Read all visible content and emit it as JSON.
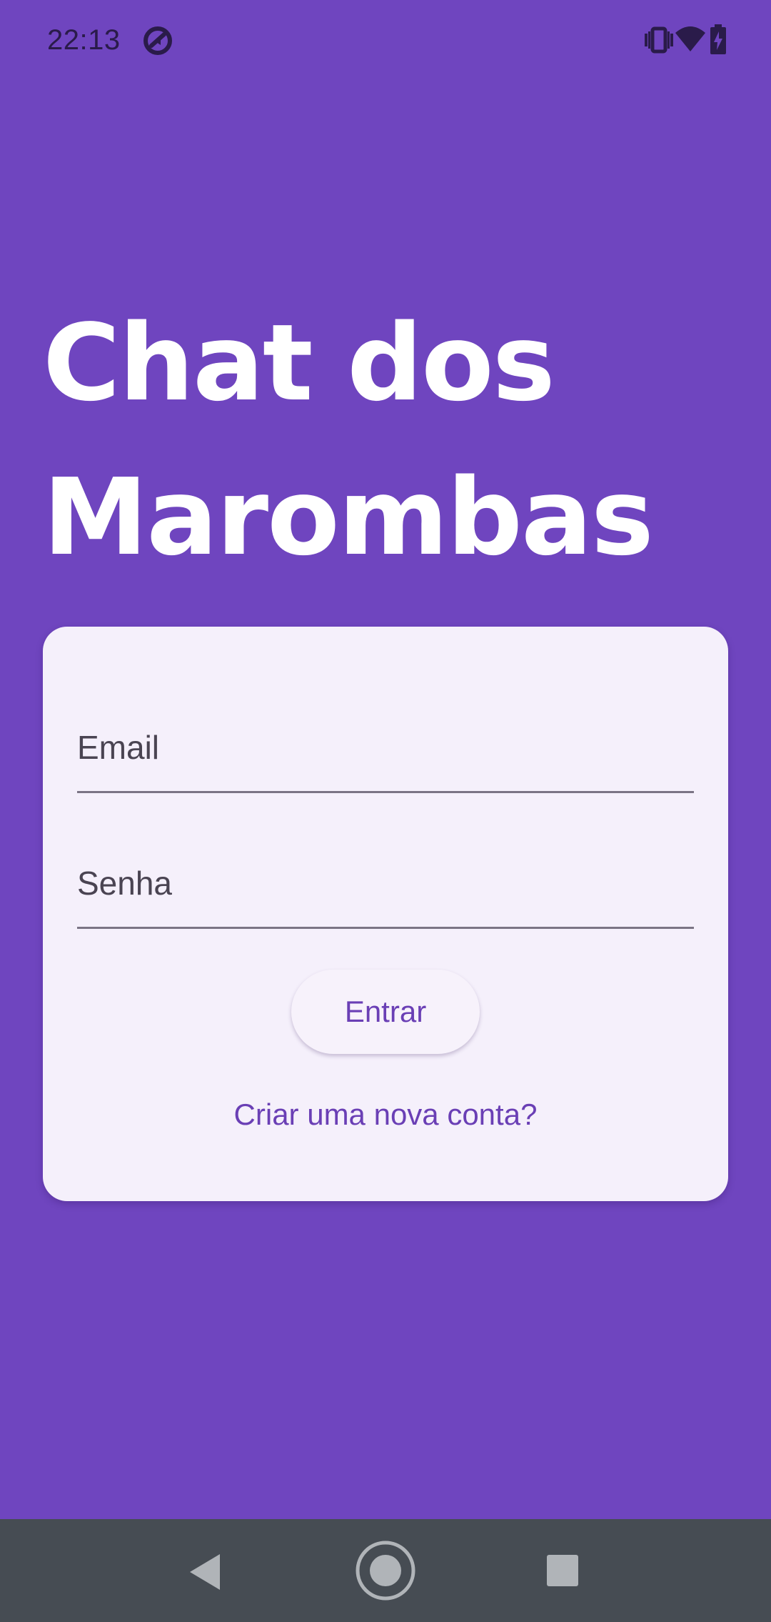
{
  "status_bar": {
    "time": "22:13",
    "icons": [
      "sync-badge-icon",
      "vibrate-icon",
      "wifi-icon",
      "battery-charging-icon"
    ]
  },
  "app": {
    "title_line1": "Chat dos",
    "title_line2": "Marombas"
  },
  "login_form": {
    "email_label": "Email",
    "email_value": "",
    "password_label": "Senha",
    "password_value": "",
    "submit_label": "Entrar",
    "create_account_link": "Criar uma nova conta?"
  },
  "navigation_bar": {
    "buttons": [
      "back-icon",
      "home-icon",
      "recents-icon"
    ]
  },
  "colors": {
    "background": "#6f45bf",
    "card": "#f5f0fb",
    "accent": "#6a3fb5",
    "nav_bar": "#464c53"
  }
}
